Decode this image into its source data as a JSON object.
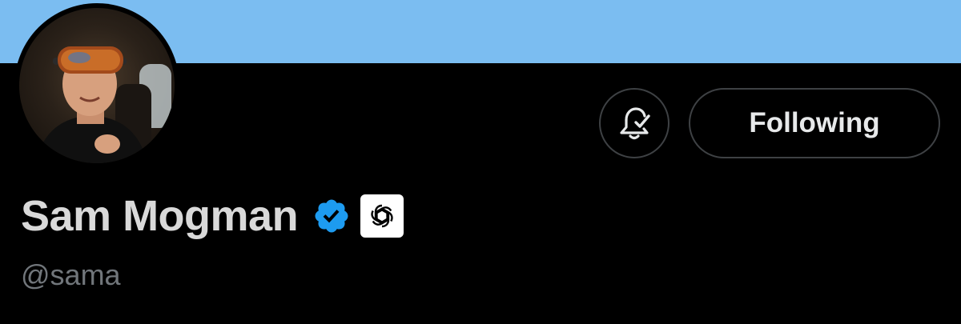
{
  "profile": {
    "display_name": "Sam Mogman",
    "handle": "@sama",
    "verified": true,
    "org_badge": "openai-logo-icon"
  },
  "actions": {
    "notify_icon": "bell-check-icon",
    "follow_label": "Following"
  },
  "colors": {
    "banner": "#7bbdf1",
    "background": "#000000",
    "name_text": "#d9d9d9",
    "handle_text": "#71767b",
    "verified_blue": "#1d9bf0",
    "button_border": "#3e4144"
  }
}
